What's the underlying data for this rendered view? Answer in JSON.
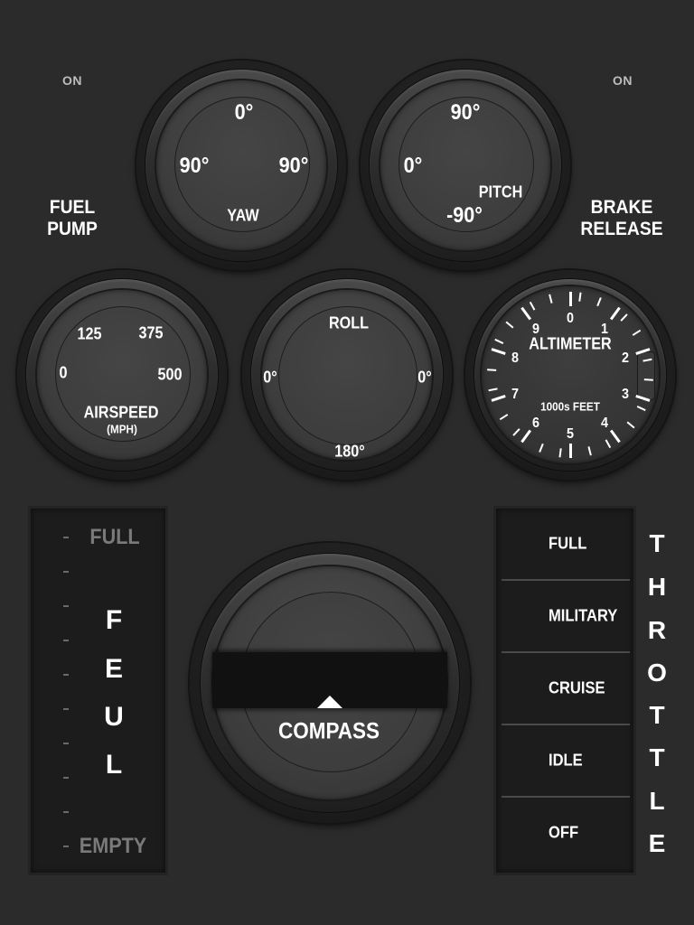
{
  "switches": {
    "fuel_pump": {
      "state": "ON",
      "label_line1": "FUEL",
      "label_line2": "PUMP"
    },
    "brake_release": {
      "state": "ON",
      "label_line1": "BRAKE",
      "label_line2": "RELEASE"
    }
  },
  "gauges": {
    "yaw": {
      "title": "YAW",
      "top": "0°",
      "left": "90°",
      "right": "90°"
    },
    "pitch": {
      "title": "PITCH",
      "top": "90°",
      "left": "0°",
      "bottom": "-90°"
    },
    "airspeed": {
      "title": "AIRSPEED",
      "unit": "(MPH)",
      "t0": "0",
      "t125": "125",
      "t375": "375",
      "t500": "500"
    },
    "roll": {
      "title": "ROLL",
      "left": "0°",
      "right": "0°",
      "bottom": "180°"
    },
    "altimeter": {
      "title": "ALTIMETER",
      "unit": "1000s FEET",
      "numbers": [
        "0",
        "1",
        "2",
        "3",
        "4",
        "5",
        "6",
        "7",
        "8",
        "9"
      ]
    },
    "compass": {
      "title": "COMPASS"
    }
  },
  "fuel": {
    "full_label": "FULL",
    "empty_label": "EMPTY",
    "letters": [
      "F",
      "E",
      "U",
      "L"
    ]
  },
  "throttle": {
    "options": [
      "FULL",
      "MILITARY",
      "CRUISE",
      "IDLE",
      "OFF"
    ],
    "letters": [
      "T",
      "H",
      "R",
      "O",
      "T",
      "T",
      "L",
      "E"
    ]
  }
}
